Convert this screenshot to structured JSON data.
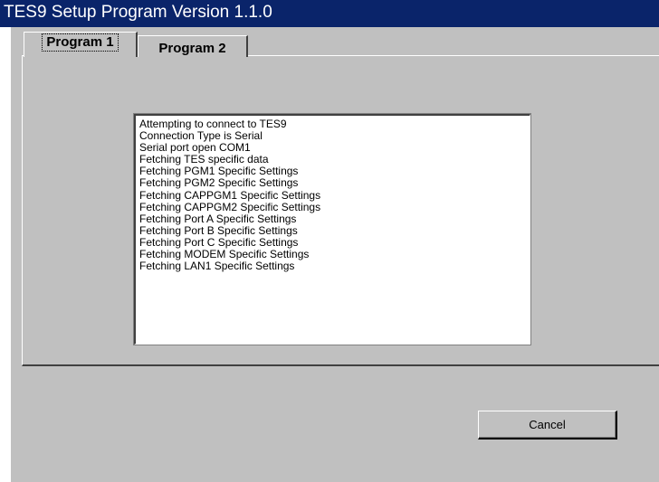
{
  "window": {
    "title": "TES9 Setup Program Version 1.1.0"
  },
  "tabs": [
    {
      "label": "Program 1",
      "selected": true
    },
    {
      "label": "Program 2",
      "selected": false
    }
  ],
  "log": {
    "lines": [
      "Attempting to connect to TES9",
      "Connection Type is Serial",
      "Serial port open COM1",
      "Fetching TES specific data",
      "Fetching PGM1 Specific Settings",
      "Fetching PGM2 Specific Settings",
      "Fetching CAPPGM1 Specific Settings",
      "Fetching CAPPGM2 Specific Settings",
      "Fetching Port A Specific Settings",
      "Fetching Port B Specific Settings",
      "Fetching Port C Specific Settings",
      "Fetching MODEM Specific Settings",
      "Fetching LAN1 Specific Settings"
    ]
  },
  "buttons": {
    "cancel_label": "Cancel"
  },
  "colors": {
    "titlebar": "#0a246a",
    "face": "#c0c0c0",
    "list_background": "#ffffff"
  }
}
